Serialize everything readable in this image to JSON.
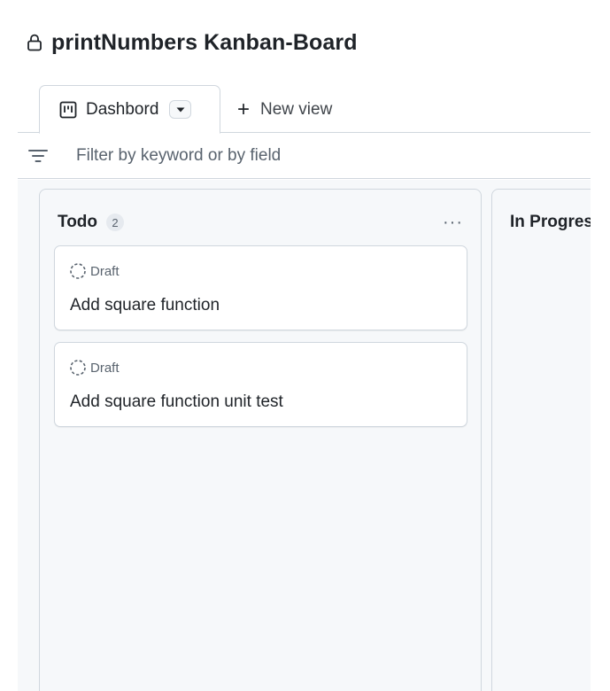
{
  "project": {
    "title": "printNumbers Kanban-Board"
  },
  "views": {
    "active_tab_label": "Dashbord",
    "new_view_label": "New view"
  },
  "filter": {
    "placeholder": "Filter by keyword or by field"
  },
  "columns": [
    {
      "title": "Todo",
      "count": "2",
      "cards": [
        {
          "status": "Draft",
          "title": "Add square function"
        },
        {
          "status": "Draft",
          "title": "Add square function unit test"
        }
      ]
    },
    {
      "title": "In Progress"
    }
  ],
  "icons": {
    "title": "lock-icon",
    "tab": "project-board-icon",
    "tab_caret": "triangle-down-icon",
    "new_view": "plus-icon",
    "filter": "filter-icon",
    "column_menu": "kebab-horizontal-icon",
    "card_status": "draft-issue-icon"
  },
  "colors": {
    "text_primary": "#1f2328",
    "text_muted": "#59636e",
    "border": "#d0d7de",
    "board_background": "#f6f8fa"
  }
}
